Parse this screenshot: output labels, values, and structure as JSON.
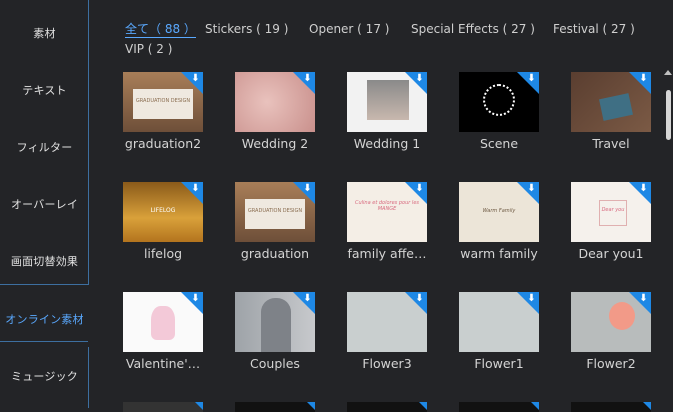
{
  "sidebar": {
    "items": [
      {
        "label": "素材"
      },
      {
        "label": "テキスト"
      },
      {
        "label": "フィルター"
      },
      {
        "label": "オーバーレイ"
      },
      {
        "label": "画面切替効果"
      },
      {
        "label": "オンライン素材",
        "active": true
      },
      {
        "label": "ミュージック"
      }
    ]
  },
  "tabs": [
    {
      "label": "全て（ 88 ）",
      "active": true
    },
    {
      "label": "Stickers ( 19 )"
    },
    {
      "label": "Opener ( 17 )"
    },
    {
      "label": "Special Effects ( 27 )"
    },
    {
      "label": "Festival ( 27 )"
    },
    {
      "label": "VIP ( 2 )"
    }
  ],
  "items": [
    {
      "label": "graduation2",
      "thumb_icon": "graduation-board-thumbnail",
      "sign": "GRADUATION DESIGN"
    },
    {
      "label": "Wedding 2",
      "thumb_icon": "pink-wedding-thumbnail"
    },
    {
      "label": "Wedding 1",
      "thumb_icon": "wedding-photo-thumbnail"
    },
    {
      "label": "Scene",
      "thumb_icon": "light-ring-thumbnail"
    },
    {
      "label": "Travel",
      "thumb_icon": "travel-desk-thumbnail"
    },
    {
      "label": "lifelog",
      "thumb_icon": "autumn-forest-thumbnail",
      "caption": "LIFELOG"
    },
    {
      "label": "graduation",
      "thumb_icon": "graduation-board-thumbnail",
      "sign": "GRADUATION DESIGN"
    },
    {
      "label": "family affe…",
      "thumb_icon": "family-script-thumbnail",
      "caption": "Culina et dolores pour les MANGE"
    },
    {
      "label": "warm family",
      "thumb_icon": "warm-family-thumbnail",
      "caption": "Warm Family"
    },
    {
      "label": "Dear you1",
      "thumb_icon": "floral-frame-thumbnail",
      "caption": "Dear you"
    },
    {
      "label": "Valentine'…",
      "thumb_icon": "valentine-couple-thumbnail"
    },
    {
      "label": "Couples",
      "thumb_icon": "couples-photo-thumbnail"
    },
    {
      "label": "Flower3",
      "thumb_icon": "petals-thumbnail"
    },
    {
      "label": "Flower1",
      "thumb_icon": "petals-thumbnail"
    },
    {
      "label": "Flower2",
      "thumb_icon": "pink-flower-thumbnail"
    }
  ],
  "colors": {
    "accent": "#5aa9ff",
    "download_badge": "#1e88e5",
    "background": "#232427"
  },
  "icons": {
    "download": "download-arrow-icon"
  }
}
